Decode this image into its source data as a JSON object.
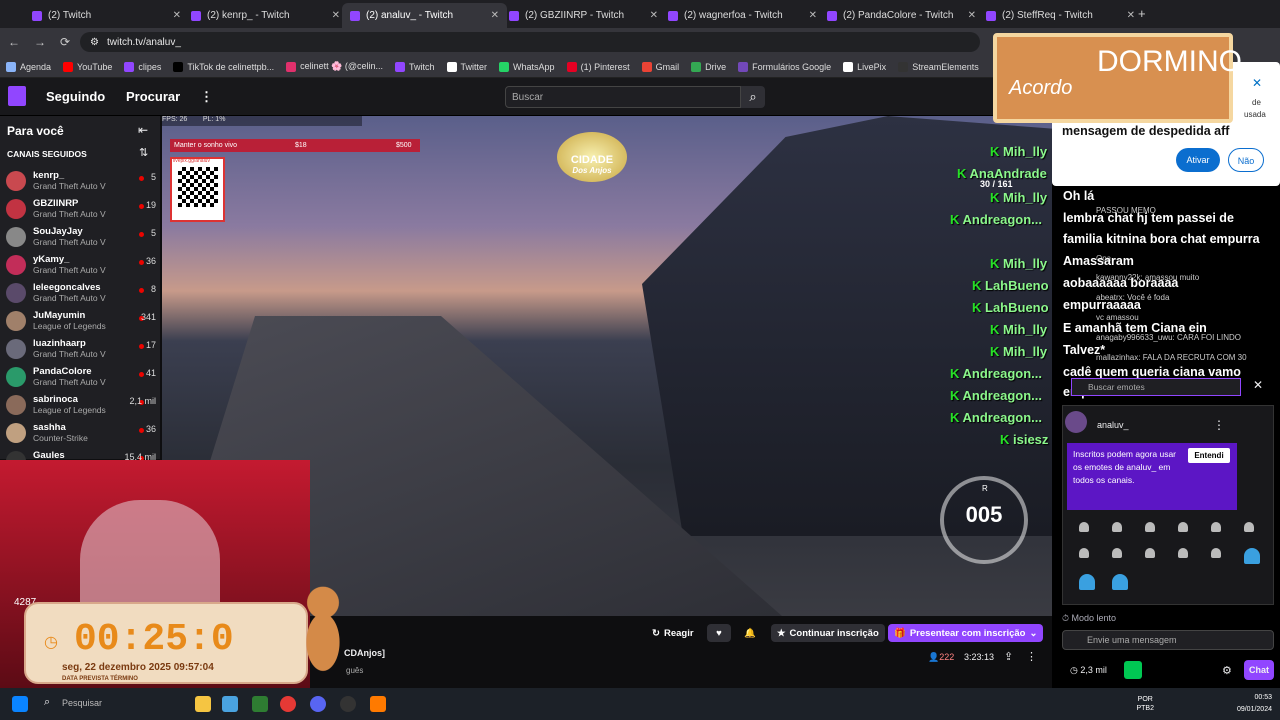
{
  "browser": {
    "tabs": [
      {
        "label": "(2) Twitch"
      },
      {
        "label": "(2) kenrp_ - Twitch"
      },
      {
        "label": "(2) analuv_ - Twitch"
      },
      {
        "label": "(2) GBZIINRP - Twitch"
      },
      {
        "label": "(2) wagnerfoa - Twitch"
      },
      {
        "label": "(2) PandaColore - Twitch"
      },
      {
        "label": "(2) SteffReq - Twitch"
      }
    ],
    "url": "twitch.tv/analuv_",
    "bookmarks": [
      "Agenda",
      "YouTube",
      "clipes",
      "TikTok de celinettpb...",
      "celinett 🌸 (@celin...",
      "Twitch",
      "Twitter",
      "WhatsApp",
      "(1) Pinterest",
      "Gmail",
      "Drive",
      "Formulários Google",
      "LivePix",
      "StreamElements"
    ]
  },
  "twitch_nav": {
    "following": "Seguindo",
    "browse": "Procurar",
    "search_placeholder": "Buscar"
  },
  "sidebar": {
    "heading": "Para você",
    "section": "CANAIS SEGUIDOS",
    "channels": [
      {
        "name": "kenrp_",
        "game": "Grand Theft Auto V",
        "viewers": "5",
        "color": "#c9494f"
      },
      {
        "name": "GBZIINRP",
        "game": "Grand Theft Auto V",
        "viewers": "19",
        "color": "#c23342"
      },
      {
        "name": "SouJayJay",
        "game": "Grand Theft Auto V",
        "viewers": "5",
        "color": "#888888"
      },
      {
        "name": "yKamy_",
        "game": "Grand Theft Auto V",
        "viewers": "36",
        "color": "#c22d59"
      },
      {
        "name": "leleegoncalves",
        "game": "Grand Theft Auto V",
        "viewers": "8",
        "color": "#5a4a6a"
      },
      {
        "name": "JuMayumin",
        "game": "League of Legends",
        "viewers": "341",
        "color": "#a0806a"
      },
      {
        "name": "luazinhaarp",
        "game": "Grand Theft Auto V",
        "viewers": "17",
        "color": "#6a6a7a"
      },
      {
        "name": "PandaColore",
        "game": "Grand Theft Auto V",
        "viewers": "41",
        "color": "#2a9a6a"
      },
      {
        "name": "sabrinoca",
        "game": "League of Legends",
        "viewers": "2,1 mil",
        "color": "#8a6a5a"
      },
      {
        "name": "sashha",
        "game": "Counter-Strike",
        "viewers": "36",
        "color": "#c0a080"
      },
      {
        "name": "Gaules",
        "game": "",
        "viewers": "15,4 mil",
        "color": "#333333"
      }
    ]
  },
  "video": {
    "fps": "FPS: 26",
    "pl": "PL: 1%",
    "meta_label": "Manter o sonho vivo",
    "meta_current": "$18",
    "meta_goal": "$500",
    "qr_caption": "livepix.gg/analuv",
    "logo_line1": "CIDADE",
    "logo_line2": "Dos Anjos",
    "hud_count": "30 / 161",
    "speed": "005",
    "gear": "R",
    "game_chat": [
      {
        "name": "Mih_lly",
        "k": true
      },
      {
        "name": "AnaAndrade",
        "k": true
      },
      {
        "name": "Mih_lly",
        "k": true
      },
      {
        "name": "Andreagon...",
        "k": true
      },
      {
        "name": "Mih_lly",
        "k": true
      },
      {
        "name": "LahBueno",
        "k": true
      },
      {
        "name": "LahBueno",
        "k": true
      },
      {
        "name": "Mih_lly",
        "k": true
      },
      {
        "name": "Mih_lly",
        "k": true
      },
      {
        "name": "Andreagon...",
        "k": true
      },
      {
        "name": "Andreagon...",
        "k": true
      },
      {
        "name": "Andreagon...",
        "k": true
      },
      {
        "name": "isiesz",
        "k": true
      }
    ]
  },
  "below_video": {
    "react": "Reagir",
    "continue_sub": "Continuar inscrição",
    "gift_sub": "Presentear com inscrição",
    "tag": "CDAnjos]",
    "lang": "guês",
    "viewers": "222",
    "uptime": "3:23:13"
  },
  "chat": {
    "big_messages": [
      "mensagem de despedida aff",
      "Oh lá",
      "lembra chat hj tem passei de",
      "familia kitnina bora chat empurra",
      "Amassaram",
      "aobaaaaaa boraaaa",
      "empurraaaaa",
      "E amanhã tem Ciana ein",
      "Talvez*",
      "cadê quem queria ciana vamo",
      "empurrar"
    ],
    "small_messages": [
      "PASSOU MEMO",
      "Opa",
      "kawanny22k: amassou muito",
      "abeatrx: Você é foda",
      "vc amassou",
      "anagaby996633_uwu: CARA FOI LINDO",
      "mallazinhax: FALA DA RECRUTA COM 30"
    ],
    "emote_search_placeholder": "Buscar emotes",
    "emote_channel": "analuv_",
    "sub_notice": "Inscritos podem agora usar os emotes de analuv_ em todos os canais.",
    "sub_notice_button": "Entendi",
    "slow_mode": "Modo lento",
    "input_placeholder": "Envie uma mensagem",
    "viewer_count": "2,3 mil",
    "chat_button": "Chat"
  },
  "overlays": {
    "board_line1": "DORMINO",
    "board_line2": "Acordo",
    "timer": "00:25:0",
    "timer_date": "seg, 22 dezembro 2025 09:57:04",
    "timer_label": "DATA PREVISTA TÉRMINO",
    "counter": "4287"
  },
  "notification": {
    "partial_top": "de",
    "partial_mid": "usada",
    "message": "mensagem de despedida aff",
    "activate": "Ativar",
    "no": "Não"
  },
  "taskbar": {
    "search_placeholder": "Pesquisar",
    "lang": "POR",
    "layout": "PTB2",
    "time": "00:53",
    "date": "09/01/2024"
  }
}
